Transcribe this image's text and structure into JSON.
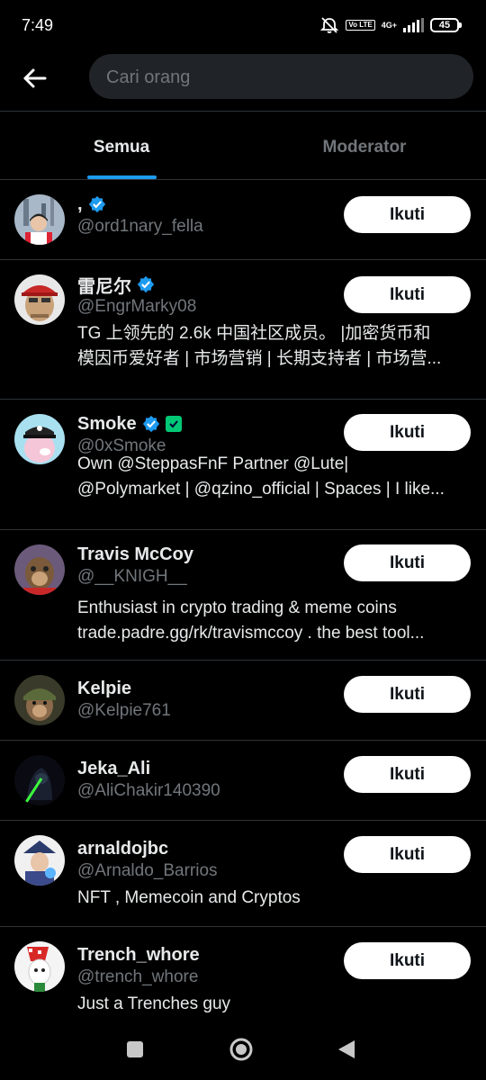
{
  "status_bar": {
    "time": "7:49",
    "network": "4G+",
    "volte": "Vo LTE",
    "battery": "45"
  },
  "header": {
    "back_icon": "arrow-left-icon",
    "search_placeholder": "Cari orang"
  },
  "tabs": [
    {
      "label": "Semua",
      "active": true
    },
    {
      "label": "Moderator",
      "active": false
    }
  ],
  "follow_label": "Ikuti",
  "users": [
    {
      "name": ",",
      "handle": "@ord1nary_fella",
      "verified": true,
      "bio": []
    },
    {
      "name": "雷尼尔",
      "handle": "@EngrMarky08",
      "verified": true,
      "bio": [
        "TG 上领先的 2.6k 中国社区成员。 |加密货币和",
        "模因币爱好者 | 市场营销 | 长期支持者 | 市场营..."
      ]
    },
    {
      "name": "Smoke",
      "handle": "@0xSmoke",
      "verified": true,
      "extra_badge": true,
      "bio": [
        "Own @SteppasFnF Partner @Lute|",
        "@Polymarket |  @qzino_official | Spaces | I like..."
      ]
    },
    {
      "name": "Travis McCoy",
      "handle": "@__KNIGH__",
      "verified": false,
      "bio": [
        "Enthusiast in crypto trading & meme coins",
        "trade.padre.gg/rk/travismccoy . the best tool..."
      ]
    },
    {
      "name": "Kelpie",
      "handle": "@Kelpie761",
      "verified": false,
      "bio": []
    },
    {
      "name": "Jeka_Ali",
      "handle": "@AliChakir140390",
      "verified": false,
      "bio": []
    },
    {
      "name": "arnaldojbc",
      "handle": "@Arnaldo_Barrios",
      "verified": false,
      "bio": [
        "NFT , Memecoin and Cryptos"
      ]
    },
    {
      "name": "Trench_whore",
      "handle": "@trench_whore",
      "verified": false,
      "bio": [
        "Just a Trenches guy"
      ]
    }
  ],
  "colors": {
    "background": "#000000",
    "accent": "#1d9bf0",
    "muted": "#71767b",
    "follow_bg": "#ffffff"
  }
}
